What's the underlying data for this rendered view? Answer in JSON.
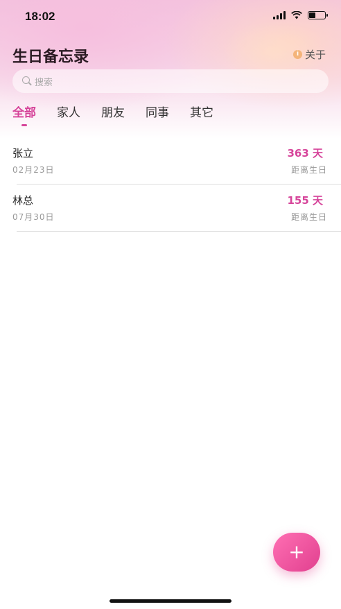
{
  "status_bar": {
    "time": "18:02"
  },
  "header": {
    "title": "生日备忘录",
    "about_label": "关于"
  },
  "search": {
    "placeholder": "搜索"
  },
  "tabs": [
    {
      "label": "全部",
      "active": true
    },
    {
      "label": "家人",
      "active": false
    },
    {
      "label": "朋友",
      "active": false
    },
    {
      "label": "同事",
      "active": false
    },
    {
      "label": "其它",
      "active": false
    }
  ],
  "birthdays": [
    {
      "name": "张立",
      "date": "02月23日",
      "days": "363 天",
      "until_label": "距离生日"
    },
    {
      "name": "林总",
      "date": "07月30日",
      "days": "155 天",
      "until_label": "距离生日"
    }
  ],
  "fab": {
    "label": "+"
  },
  "colors": {
    "accent": "#d6449a",
    "fab_start": "#ff6fb3",
    "fab_end": "#e1408f"
  }
}
